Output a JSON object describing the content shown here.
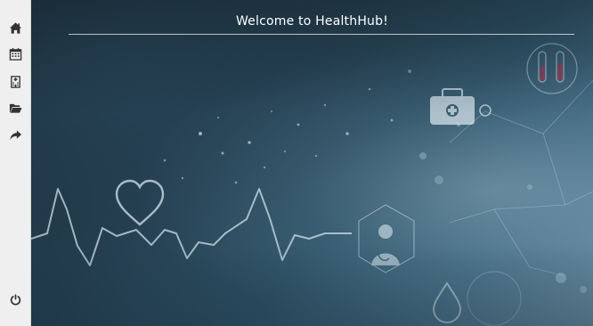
{
  "sidebar": {
    "items": [
      {
        "icon": "home-icon"
      },
      {
        "icon": "calendar-icon"
      },
      {
        "icon": "hospital-icon"
      },
      {
        "icon": "folder-open-icon"
      },
      {
        "icon": "share-arrow-icon"
      }
    ],
    "logout": {
      "icon": "power-icon"
    }
  },
  "main": {
    "title": "Welcome to HealthHub!"
  },
  "colors": {
    "sidebar_bg": "#efefef",
    "icon": "#333333",
    "title_text": "#ffffff"
  }
}
